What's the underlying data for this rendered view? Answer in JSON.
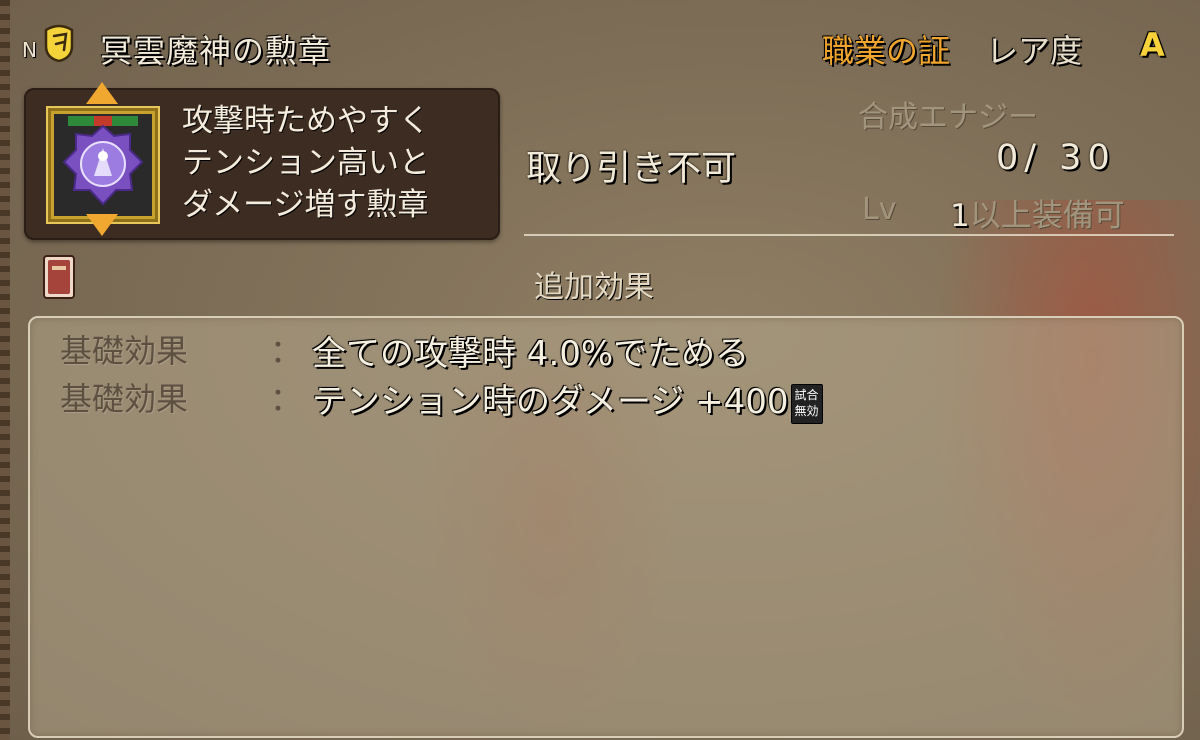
{
  "header": {
    "rank": "N",
    "item_name": "冥雲魔神の勲章",
    "category": "職業の証",
    "rarity_label": "レア度",
    "rarity_value": "A"
  },
  "description": {
    "lines": [
      "攻撃時ためやすく",
      "テンション高いと",
      "ダメージ増す勲章"
    ]
  },
  "trade_status": "取り引き不可",
  "synthesis": {
    "label": "合成エナジー",
    "value": "0/ 30"
  },
  "level": {
    "label": "Lv",
    "value": "1",
    "suffix": "以上装備可"
  },
  "extra_effects_label": "追加効果",
  "effects": [
    {
      "label": "基礎効果",
      "colon": "：",
      "value": "全ての攻撃時 4.0%でためる"
    },
    {
      "label": "基礎効果",
      "colon": "：",
      "value": "テンション時のダメージ +400",
      "badge": [
        "試合",
        "無効"
      ]
    }
  ],
  "colors": {
    "category": "#f0a62e",
    "rarity": "#f7d23a",
    "icon_frame": "#c9a22e",
    "arrow": "#f1a830"
  }
}
